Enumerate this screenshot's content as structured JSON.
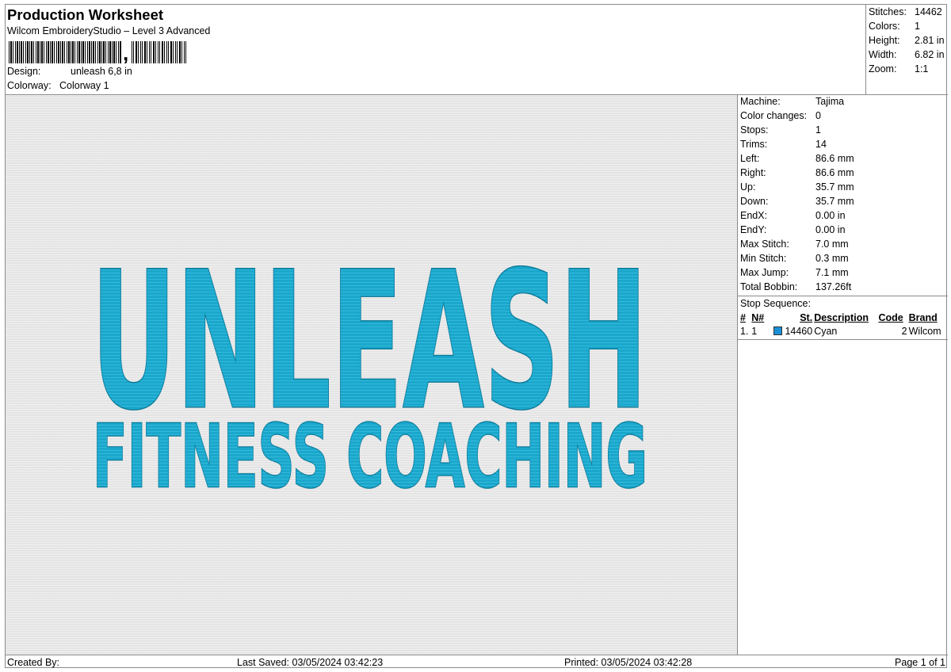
{
  "header": {
    "title": "Production Worksheet",
    "subtitle": "Wilcom EmbroideryStudio – Level 3 Advanced",
    "barcode_comma": ",",
    "design_label": "Design:",
    "design_value": "unleash 6,8 in",
    "colorway_label": "Colorway:",
    "colorway_value": "Colorway 1"
  },
  "summary": [
    {
      "label": "Stitches:",
      "value": "14462"
    },
    {
      "label": "Colors:",
      "value": "1"
    },
    {
      "label": "Height:",
      "value": "2.81 in"
    },
    {
      "label": "Width:",
      "value": "6.82 in"
    },
    {
      "label": "Zoom:",
      "value": "1:1"
    }
  ],
  "design_preview": {
    "line1": "UNLEASH",
    "line2": "FITNESS COACHING",
    "thread_color": "#1aa7cc",
    "thread_shadow": "#0b7b9a"
  },
  "details": [
    {
      "label": "Machine:",
      "value": "Tajima"
    },
    {
      "label": "Color changes:",
      "value": "0"
    },
    {
      "label": "Stops:",
      "value": "1"
    },
    {
      "label": "Trims:",
      "value": "14"
    },
    {
      "label": "Left:",
      "value": "86.6 mm"
    },
    {
      "label": "Right:",
      "value": "86.6 mm"
    },
    {
      "label": "Up:",
      "value": "35.7 mm"
    },
    {
      "label": "Down:",
      "value": "35.7 mm"
    },
    {
      "label": "EndX:",
      "value": "0.00 in"
    },
    {
      "label": "EndY:",
      "value": "0.00 in"
    },
    {
      "label": "Max Stitch:",
      "value": "7.0 mm"
    },
    {
      "label": "Min Stitch:",
      "value": "0.3 mm"
    },
    {
      "label": "Max Jump:",
      "value": "7.1 mm"
    },
    {
      "label": "Total Bobbin:",
      "value": "137.26ft"
    }
  ],
  "stop_sequence": {
    "title": "Stop Sequence:",
    "columns": [
      "#",
      "N#",
      "St.",
      "Description",
      "Code",
      "Brand"
    ],
    "rows": [
      {
        "index": "1.",
        "n": "1",
        "stitches": "14460",
        "description": "Cyan",
        "code": "2",
        "brand": "Wilcom",
        "color": "#1a8fd6"
      }
    ]
  },
  "footer": {
    "created_by": "Created By:",
    "last_saved": "Last Saved: 03/05/2024 03:42:23",
    "printed": "Printed: 03/05/2024 03:42:28",
    "page": "Page 1 of 1"
  }
}
